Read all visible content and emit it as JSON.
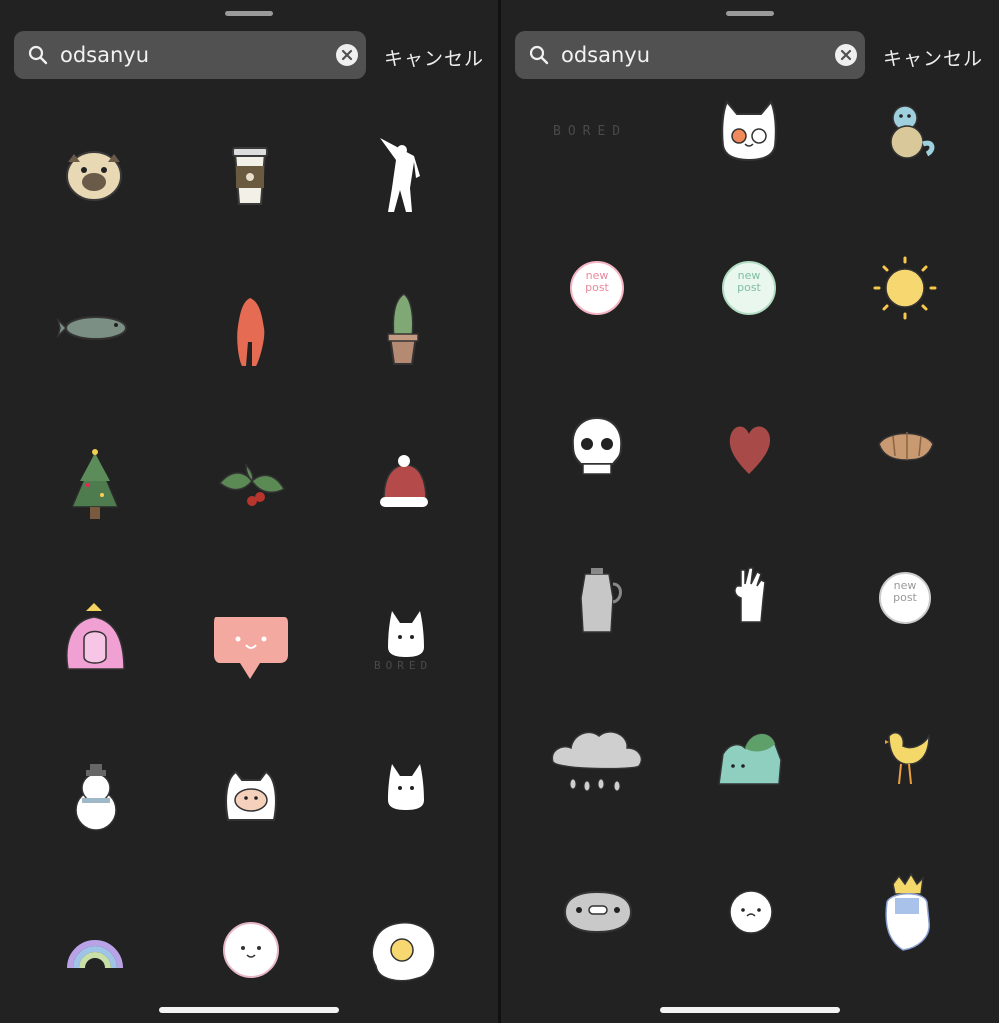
{
  "panels": [
    {
      "search": {
        "value": "odsanyu",
        "placeholder": "Search"
      },
      "cancel_label": "キャンセル",
      "stickers": [
        "pug",
        "coffee-cup",
        "dancing-figure",
        "fish",
        "orange-figure",
        "cactus",
        "christmas-tree",
        "holly",
        "santa-hat",
        "princess-bubblegum",
        "speech-bubble-face",
        "bored-cat",
        "snowman",
        "finn-hat",
        "white-cat",
        "rainbow",
        "round-face",
        "fried-egg"
      ],
      "bored_caption": "BORED"
    },
    {
      "search": {
        "value": "odsanyu",
        "placeholder": "Search"
      },
      "cancel_label": "キャンセル",
      "stickers": [
        "bored-text",
        "cat-face",
        "squirtle",
        "new-post-pink",
        "new-post-mint",
        "sun",
        "skull",
        "heart",
        "croissant",
        "moka-pot",
        "ok-hand",
        "new-post-white",
        "rain-cloud",
        "bulbasaur",
        "yellow-bird",
        "grey-blob",
        "little-face",
        "ice-king"
      ],
      "bored_caption": "BORED"
    }
  ],
  "new_post_label": "new post",
  "colors": {
    "background": "#222222",
    "search_bg": "#515151",
    "text": "#f2f2f2"
  }
}
